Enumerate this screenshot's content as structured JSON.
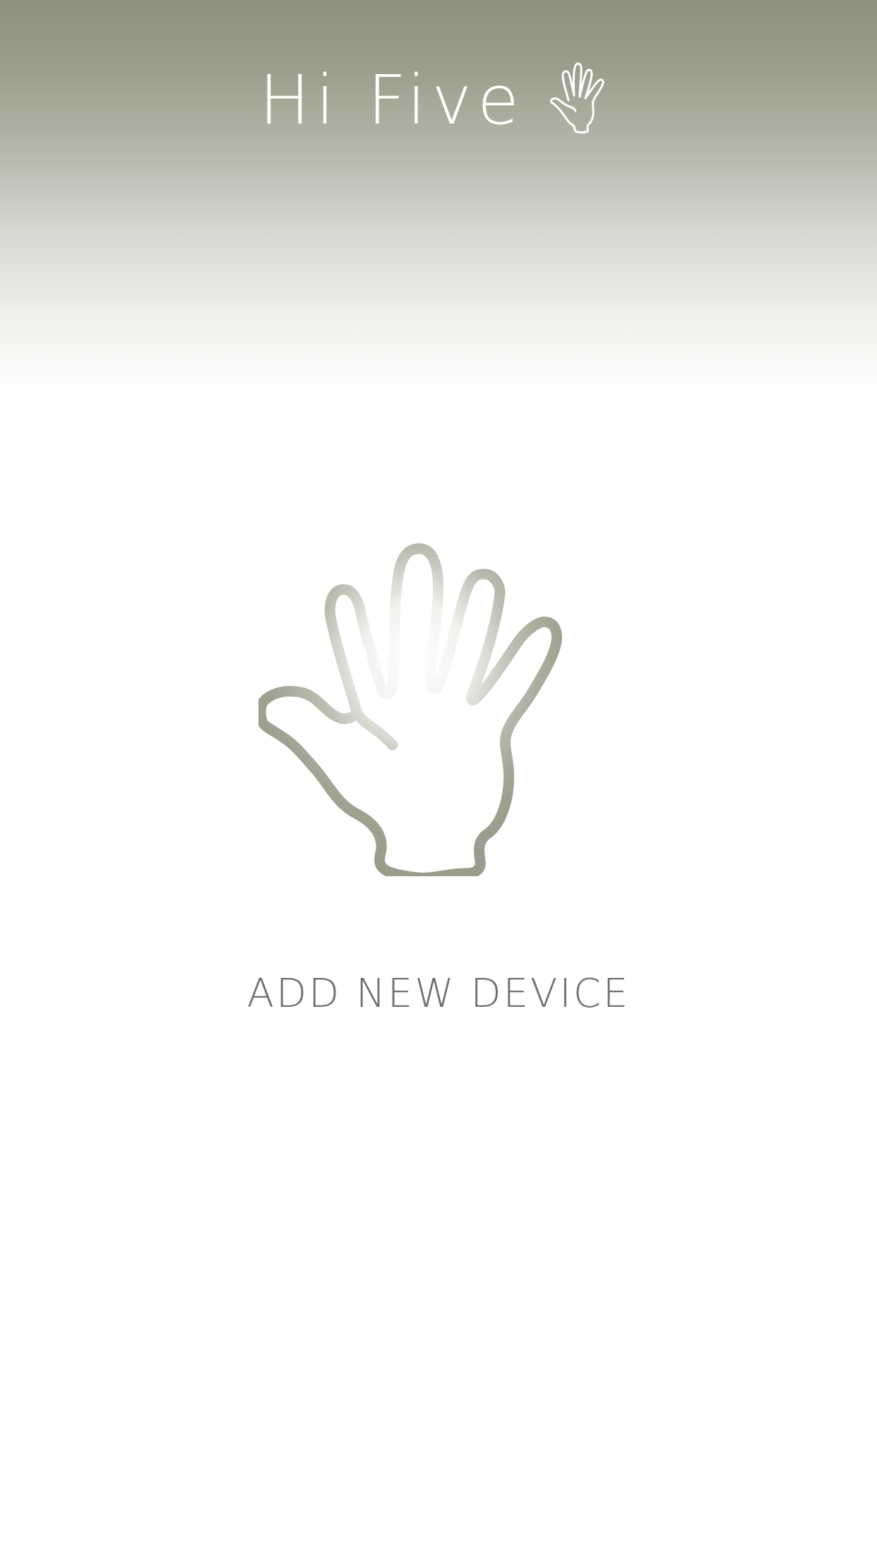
{
  "app": {
    "title": "Hi Five"
  },
  "icons": {
    "brand": "hand-icon",
    "hero": "hand-icon"
  },
  "main": {
    "action_label": "ADD NEW DEVICE"
  },
  "colors": {
    "header_top": "#8c917d",
    "hand_stroke": "#9fa291",
    "label_text": "#6e6e6e",
    "background": "#ffffff"
  }
}
